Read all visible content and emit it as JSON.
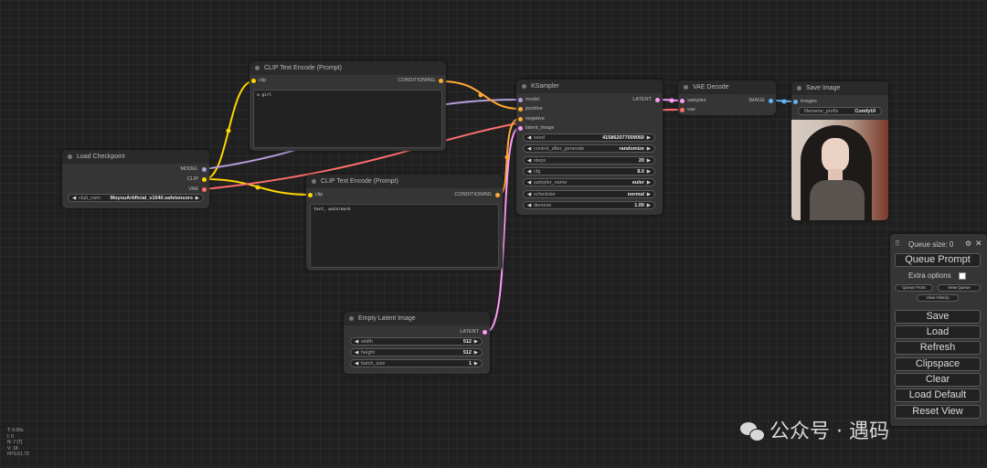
{
  "nodes": {
    "load_checkpoint": {
      "title": "Load Checkpoint",
      "outputs": [
        "MODEL",
        "CLIP",
        "VAE"
      ],
      "ckpt_name": {
        "name": "ckpt_nam",
        "value": "MoyouArtificial_v1040.safetensors"
      }
    },
    "clip_pos": {
      "title": "CLIP Text Encode (Prompt)",
      "input": "clip",
      "output": "CONDITIONING",
      "text": "a girl"
    },
    "clip_neg": {
      "title": "CLIP Text Encode (Prompt)",
      "input": "clip",
      "output": "CONDITIONING",
      "text": "text, watermark"
    },
    "ksampler": {
      "title": "KSampler",
      "inputs": [
        "model",
        "positive",
        "negative",
        "latent_image"
      ],
      "output": "LATENT",
      "widgets": [
        {
          "name": "seed",
          "value": "415862077009050"
        },
        {
          "name": "control_after_generate",
          "value": "randomize"
        },
        {
          "name": "steps",
          "value": "20"
        },
        {
          "name": "cfg",
          "value": "8.0"
        },
        {
          "name": "sampler_name",
          "value": "euler"
        },
        {
          "name": "scheduler",
          "value": "normal"
        },
        {
          "name": "denoise",
          "value": "1.00"
        }
      ]
    },
    "vae_decode": {
      "title": "VAE Decode",
      "inputs": [
        "samples",
        "vae"
      ],
      "output": "IMAGE"
    },
    "save_image": {
      "title": "Save Image",
      "input": "images",
      "filename_prefix": {
        "name": "filename_prefix",
        "value": "ComfyUI"
      }
    },
    "empty_latent": {
      "title": "Empty Latent Image",
      "output": "LATENT",
      "widgets": [
        {
          "name": "width",
          "value": "512"
        },
        {
          "name": "height",
          "value": "512"
        },
        {
          "name": "batch_size",
          "value": "1"
        }
      ]
    }
  },
  "panel": {
    "queue_size": "Queue size: 0",
    "queue_prompt": "Queue Prompt",
    "extra_options": "Extra options",
    "queue_front": "Queue Front",
    "view_queue": "View Queue",
    "view_history": "View History",
    "buttons": [
      "Save",
      "Load",
      "Refresh",
      "Clipspace",
      "Clear",
      "Load Default",
      "Reset View"
    ]
  },
  "stats": [
    "T: 0.00s",
    "I: 0",
    "N: 7 [7]",
    "V: 18",
    "FPS:61.73"
  ],
  "watermark": "公众号 · 遇码",
  "colors": {
    "model": "#b39ddb",
    "clip": "#ffd500",
    "vae": "#ff6e6e",
    "conditioning": "#ffa931",
    "latent": "#ff9cf9",
    "image": "#64b5f6"
  }
}
